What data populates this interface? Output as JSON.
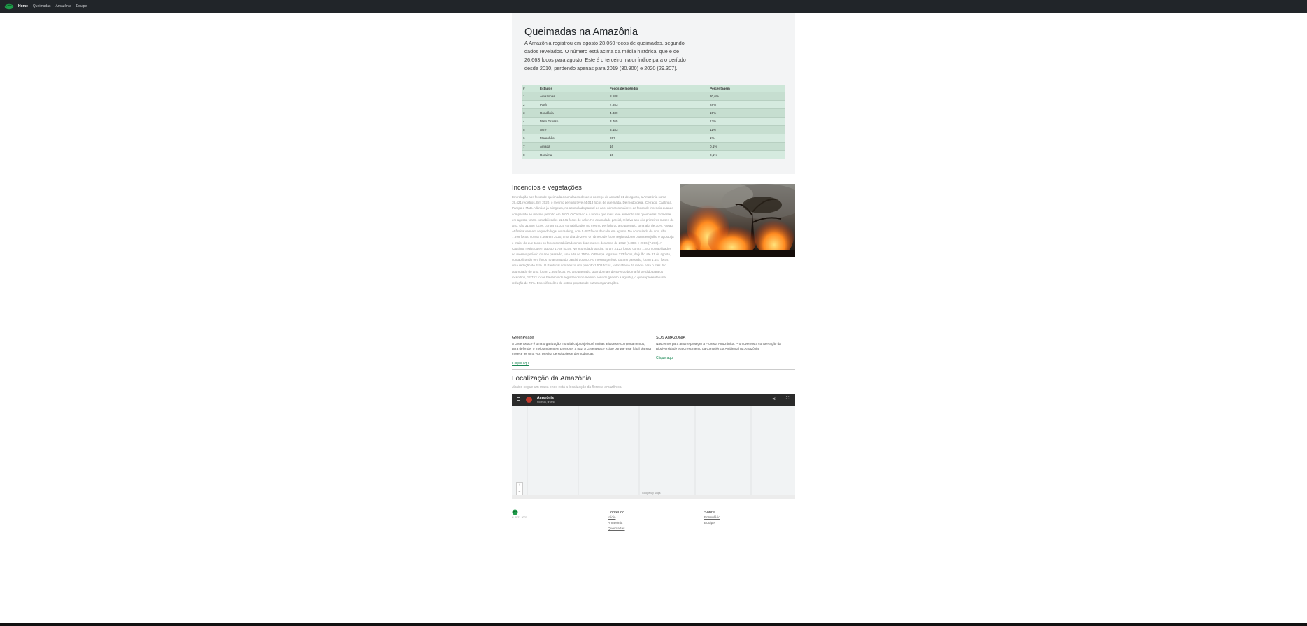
{
  "nav": {
    "brand_icon": "amazon-leaf-logo",
    "links": [
      {
        "label": "Home",
        "active": true
      },
      {
        "label": "Queimadas",
        "active": false
      },
      {
        "label": "Amazônia",
        "active": false
      },
      {
        "label": "Equipe",
        "active": false
      }
    ]
  },
  "hero": {
    "title": "Queimadas na Amazônia",
    "text": "A Amazônia registrou em agosto 28.060 focos de queimadas, segundo dados revelados. O número está acima da média histórica, que é de 26.663 focos para agosto. Este é o terceiro maior índice para o período desde 2010, perdendo apenas para 2019 (30.900) e 2020 (29.307)."
  },
  "table": {
    "headers": [
      "#",
      "Estados",
      "Focos de Incêndio",
      "Percentagem"
    ],
    "rows": [
      [
        "1",
        "Amazonas",
        "8.588",
        "30,6%"
      ],
      [
        "2",
        "Pará",
        "7.853",
        "28%"
      ],
      [
        "3",
        "Rondônia",
        "4.339",
        "15%"
      ],
      [
        "4",
        "Mato Grosso",
        "3.765",
        "13%"
      ],
      [
        "5",
        "Acre",
        "3.183",
        "11%"
      ],
      [
        "6",
        "Maranhão",
        "267",
        "1%"
      ],
      [
        "7",
        "Amapá",
        "16",
        "0,1%"
      ],
      [
        "8",
        "Roraima",
        "15",
        "0,1%"
      ]
    ]
  },
  "incendios": {
    "title": "Incendios e vegetações",
    "text": "Em relação aos focos de queimada acumulados desde o começo do ano até 31 de agosto, a Amazônia soma 39.421 registros. Em 2020, o mesmo período teve 44.013 focos de queimada. De modo geral, Cerrado, Caatinga, Pampa e Mata Atlântica já atingiram, no acumulado parcial do ano, números maiores de focos de incêndio quando comparado ao mesmo período em 2020. O Cerrado é o bioma que mais teve aumento nas queimadas. Somente em agosto, foram contabilizados 11.041 focos de calor. No acumulado parcial, relativo aos oito primeiros meses do ano, são 31.566 focos, contra 24.035 contabilizados no mesmo período do ano passado, uma alta de 30%. A Mata Atlântica vem em segundo lugar no ranking, com 5.087 focos de calor em agosto. No acumulado do ano, são 7.699 focos, contra 5.466 em 2020, uma alta de 29%. O número de focos registrado no bioma em julho e agosto já é maior do que todos os focos contabilizados nos doze meses dos anos de 2012 (7.388) e 2016 (7.216). A Caatinga registrou em agosto 1.756 focos. No acumulado parcial, foram 3.123 focos, contra 1.643 contabilizados no mesmo período do ano passado, uma alta de 157%. O Pampa registrou 273 focos, de julho até 31 de agosto, contabilizando 997 focos no acumulado parcial do ano. No mesmo período do ano passado, foram 1.447 focos, uma redução de 31%. O Pantanal contabilizou no período 1.508 focos, valor abaixo da média para o mês. No acumulado do ano, foram 2.394 focos. No ano passado, quando mais de 40% do bioma foi perdido para os incêndios, 12.753 focos haviam sido registrados no mesmo período (janeiro a agosto), o que representa uma redução de 78%. Especificações de outros projetos de outras organizações.",
    "image_label": "amazon-forest-fire-photo"
  },
  "orgs": [
    {
      "title": "GreenPeace",
      "text": "A Greenpeace é uma organização mundial cujo objetivo é muitas atitudes e comportamentos, para defender o meio ambiente e promover a paz. A Greenpeace existe porque este frágil planeta merece ter uma voz, precisa de soluções e de mudanças.",
      "link": "Clique aqui"
    },
    {
      "title": "SOS AMAZONIA",
      "text": "Nascemos para amar e proteger a Floresta Amazônica. Promovemos a conservação da Biodiversidade e a Crescimento da Consciência Ambiental na Amazônia.",
      "link": "Clique aqui"
    }
  ],
  "location": {
    "title": "Localização da Amazônia",
    "subtitle": "Abaixo segue um mapa onde está a localização da floresta amazônica.",
    "map_title": "Amazônia",
    "map_subtitle": "Floresta, urbano"
  },
  "footer": {
    "copyright": "© 2021-2021",
    "conteudo": {
      "title": "Conteúdo",
      "links": [
        "Início",
        "Amazônia",
        "Queimadas"
      ]
    },
    "sobre": {
      "title": "Sobre",
      "links": [
        "Formulário",
        "Equipe"
      ]
    }
  }
}
